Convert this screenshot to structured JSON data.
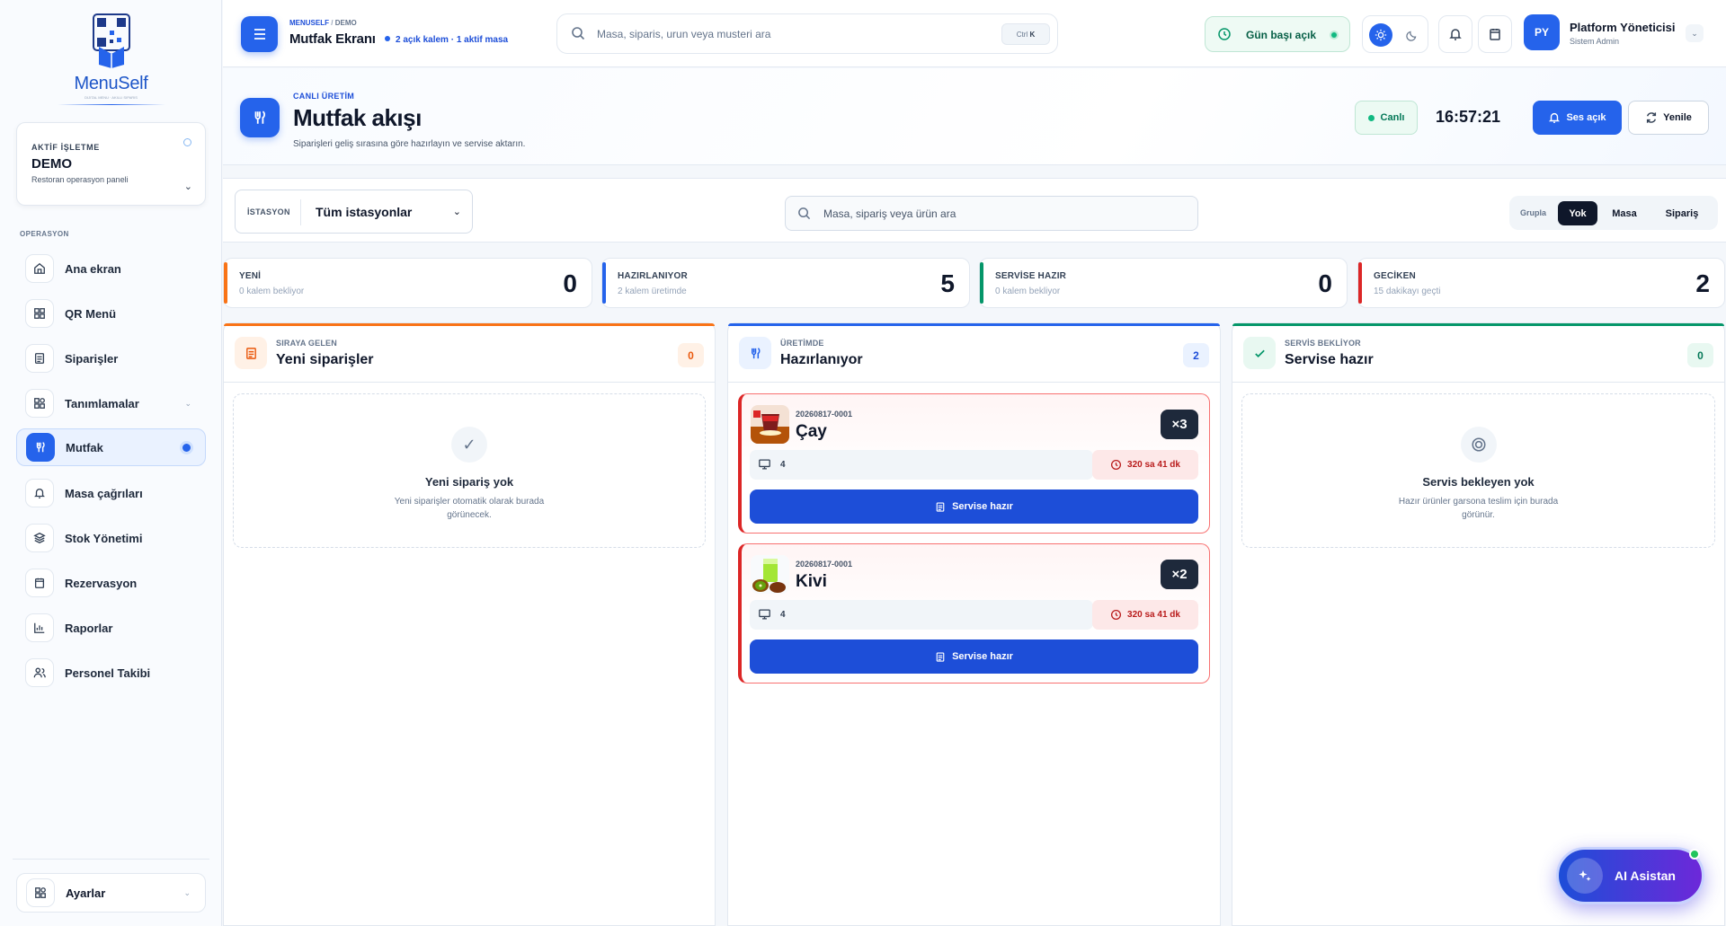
{
  "sidebar": {
    "brand": "MenuSelf",
    "tagline": "DIJITAL MENU · AKILLI SIPARIS",
    "business": {
      "label": "AKTİF İŞLETME",
      "name": "DEMO",
      "subtitle": "Restoran operasyon paneli"
    },
    "section": "OPERASYON",
    "items": [
      {
        "label": "Ana ekran",
        "icon": "home-icon"
      },
      {
        "label": "QR Menü",
        "icon": "grid-icon"
      },
      {
        "label": "Siparişler",
        "icon": "receipt-icon"
      },
      {
        "label": "Tanımlamalar",
        "icon": "layout-icon"
      },
      {
        "label": "Mutfak",
        "icon": "utensils-icon"
      },
      {
        "label": "Masa çağrıları",
        "icon": "bell-icon"
      },
      {
        "label": "Stok Yönetimi",
        "icon": "box-icon"
      },
      {
        "label": "Rezervasyon",
        "icon": "calendar-icon"
      },
      {
        "label": "Raporlar",
        "icon": "chart-icon"
      },
      {
        "label": "Personel Takibi",
        "icon": "users-icon"
      }
    ],
    "settings": "Ayarlar"
  },
  "topbar": {
    "crumb_root": "MENUSELF",
    "crumb_sep": "/",
    "crumb_leaf": "DEMO",
    "title": "Mutfak Ekranı",
    "meta": "2 açık kalem · 1 aktif masa",
    "search_placeholder": "Masa, siparis, urun veya musteri ara",
    "shortcut_ctrl": "Ctrl",
    "shortcut_key": "K",
    "day_status": "Gün başı açık",
    "user_name": "Platform Yöneticisi",
    "user_role": "Sistem Admin",
    "user_initials": "PY"
  },
  "hero": {
    "kicker": "CANLI ÜRETİM",
    "title": "Mutfak akışı",
    "subtitle": "Siparişleri geliş sırasına göre hazırlayın ve servise aktarın.",
    "live": "Canlı",
    "clock": "16:57:21",
    "sound": "Ses açık",
    "refresh": "Yenile"
  },
  "filters": {
    "station_label": "İSTASYON",
    "station_value": "Tüm istasyonlar",
    "search_placeholder": "Masa, sipariş veya ürün ara",
    "group_label": "Grupla",
    "group_options": [
      "Yok",
      "Masa",
      "Sipariş"
    ],
    "group_selected": "Yok"
  },
  "stats": [
    {
      "title": "YENİ",
      "sub": "0 kalem bekliyor",
      "value": "0",
      "color": "#f97316"
    },
    {
      "title": "HAZIRLANIYOR",
      "sub": "2 kalem üretimde",
      "value": "5",
      "color": "#2563eb"
    },
    {
      "title": "SERVİSE HAZIR",
      "sub": "0 kalem bekliyor",
      "value": "0",
      "color": "#059669"
    },
    {
      "title": "GECİKEN",
      "sub": "15 dakikayı geçti",
      "value": "2",
      "color": "#dc2626"
    }
  ],
  "columns": {
    "new": {
      "kicker": "SIRAYA GELEN",
      "title": "Yeni siparişler",
      "count": "0",
      "empty_title": "Yeni sipariş yok",
      "empty_desc": "Yeni siparişler otomatik olarak burada görünecek.",
      "color": "#f97316"
    },
    "prep": {
      "kicker": "ÜRETİMDE",
      "title": "Hazırlanıyor",
      "count": "2",
      "color": "#2563eb"
    },
    "ready": {
      "kicker": "SERVİS BEKLİYOR",
      "title": "Servise hazır",
      "count": "0",
      "empty_title": "Servis bekleyen yok",
      "empty_desc": "Hazır ürünler garsona teslim için burada görünür.",
      "color": "#059669"
    }
  },
  "orders": [
    {
      "order_no": "20260817-0001",
      "product": "Çay",
      "qty": "×3",
      "table": "4",
      "elapsed": "320 sa 41 dk",
      "action": "Servise hazır"
    },
    {
      "order_no": "20260817-0001",
      "product": "Kivi",
      "qty": "×2",
      "table": "4",
      "elapsed": "320 sa 41 dk",
      "action": "Servise hazır"
    }
  ],
  "ai": {
    "label": "AI Asistan"
  }
}
